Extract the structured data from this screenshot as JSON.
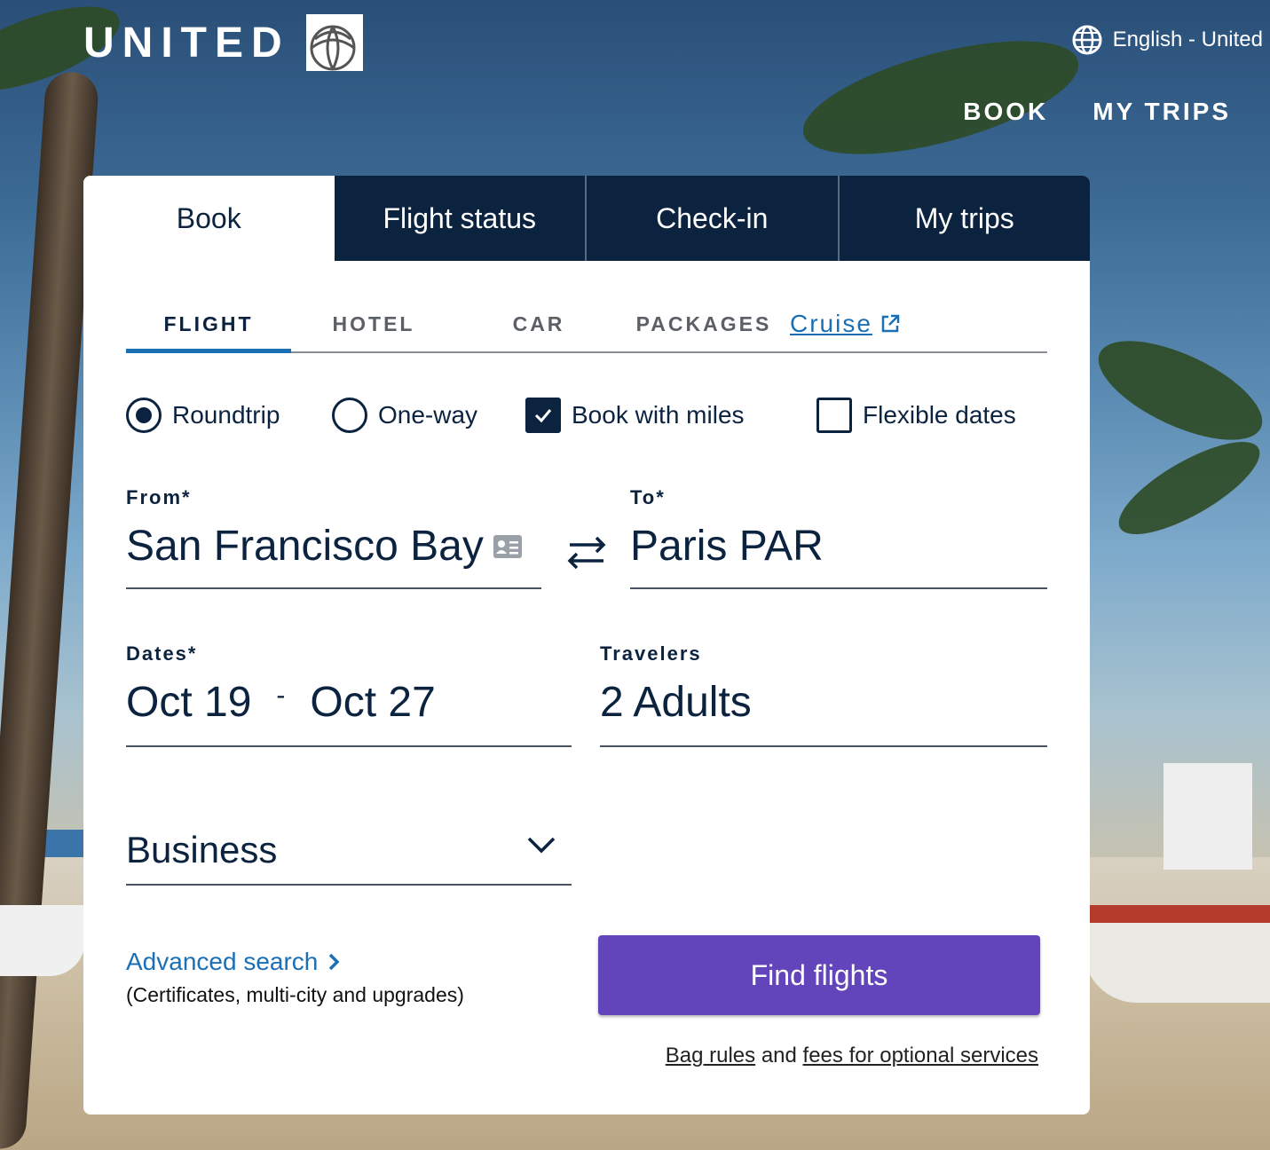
{
  "brand": {
    "name": "UNITED"
  },
  "header": {
    "language": "English - United",
    "nav": [
      "BOOK",
      "MY TRIPS"
    ]
  },
  "tabs": [
    {
      "label": "Book",
      "active": true
    },
    {
      "label": "Flight status",
      "active": false
    },
    {
      "label": "Check-in",
      "active": false
    },
    {
      "label": "My trips",
      "active": false
    }
  ],
  "subtabs": [
    {
      "label": "FLIGHT",
      "active": true
    },
    {
      "label": "HOTEL",
      "active": false
    },
    {
      "label": "CAR",
      "active": false
    },
    {
      "label": "PACKAGES",
      "active": false
    },
    {
      "label": "Cruise",
      "active": false
    }
  ],
  "trip_options": {
    "roundtrip": {
      "label": "Roundtrip",
      "selected": true
    },
    "oneway": {
      "label": "One-way",
      "selected": false
    },
    "book_with_miles": {
      "label": "Book with miles",
      "checked": true
    },
    "flexible_dates": {
      "label": "Flexible dates",
      "checked": false
    }
  },
  "from": {
    "label": "From*",
    "value": "San Francisco Bay ..."
  },
  "to": {
    "label": "To*",
    "value": "Paris PAR"
  },
  "dates": {
    "label": "Dates*",
    "depart": "Oct 19",
    "separator": "-",
    "return": "Oct 27"
  },
  "travelers": {
    "label": "Travelers",
    "value": "2 Adults"
  },
  "cabin": {
    "value": "Business"
  },
  "advanced": {
    "link": "Advanced search",
    "sub": "(Certificates, multi-city and upgrades)"
  },
  "find_button": "Find flights",
  "bag": {
    "link1": "Bag rules",
    "mid": "and",
    "link2": "fees for optional services"
  },
  "colors": {
    "navy": "#0c2340",
    "blue_link": "#1a6fb5",
    "purple": "#6244bb"
  }
}
